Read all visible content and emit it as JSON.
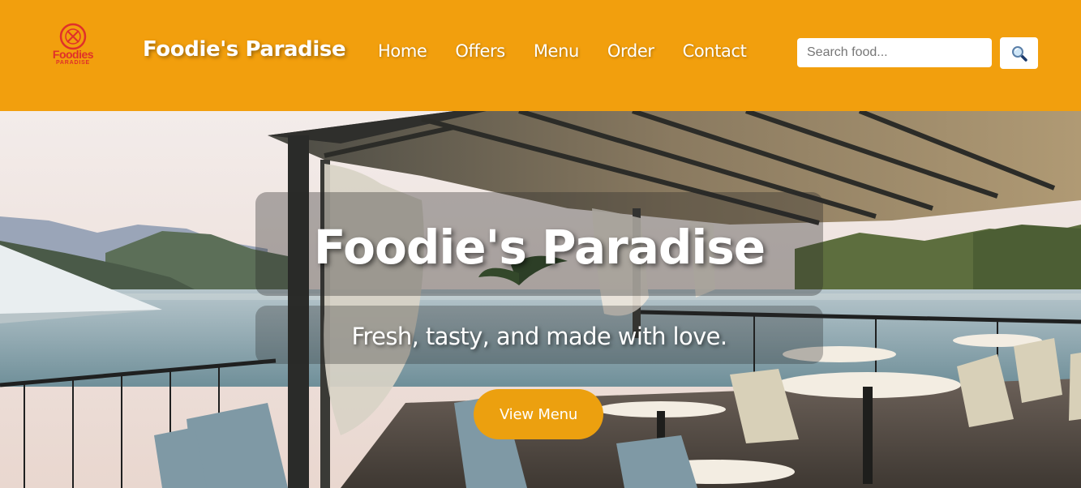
{
  "header": {
    "logo": {
      "word": "Foodies",
      "sub": "PARADISE"
    },
    "brand": "Foodie's Paradise",
    "nav": [
      "Home",
      "Offers",
      "Menu",
      "Order",
      "Contact"
    ],
    "search": {
      "placeholder": "Search food...",
      "value": ""
    },
    "search_button_icon": "magnifier-icon"
  },
  "hero": {
    "title": "Foodie's Paradise",
    "subtitle": "Fresh, tasty, and made with love.",
    "cta_label": "View Menu"
  },
  "colors": {
    "header_bg": "#f29f0d",
    "cta_bg": "#eca00f",
    "logo_red": "#e0302a",
    "text": "#ffffff"
  }
}
